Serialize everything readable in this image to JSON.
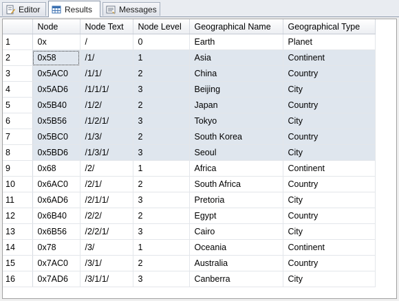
{
  "tabs": [
    {
      "label": "Editor",
      "icon": "editor-icon",
      "active": false
    },
    {
      "label": "Results",
      "icon": "results-grid-icon",
      "active": true
    },
    {
      "label": "Messages",
      "icon": "messages-icon",
      "active": false
    }
  ],
  "grid": {
    "columns": [
      "Node",
      "Node Text",
      "Node Level",
      "Geographical Name",
      "Geographical Type"
    ],
    "rows": [
      {
        "num": "1",
        "cells": [
          "0x",
          "/",
          "0",
          "Earth",
          "Planet"
        ]
      },
      {
        "num": "2",
        "cells": [
          "0x58",
          "/1/",
          "1",
          "Asia",
          "Continent"
        ]
      },
      {
        "num": "3",
        "cells": [
          "0x5AC0",
          "/1/1/",
          "2",
          "China",
          "Country"
        ]
      },
      {
        "num": "4",
        "cells": [
          "0x5AD6",
          "/1/1/1/",
          "3",
          "Beijing",
          "City"
        ]
      },
      {
        "num": "5",
        "cells": [
          "0x5B40",
          "/1/2/",
          "2",
          "Japan",
          "Country"
        ]
      },
      {
        "num": "6",
        "cells": [
          "0x5B56",
          "/1/2/1/",
          "3",
          "Tokyo",
          "City"
        ]
      },
      {
        "num": "7",
        "cells": [
          "0x5BC0",
          "/1/3/",
          "2",
          "South Korea",
          "Country"
        ]
      },
      {
        "num": "8",
        "cells": [
          "0x5BD6",
          "/1/3/1/",
          "3",
          "Seoul",
          "City"
        ]
      },
      {
        "num": "9",
        "cells": [
          "0x68",
          "/2/",
          "1",
          "Africa",
          "Continent"
        ]
      },
      {
        "num": "10",
        "cells": [
          "0x6AC0",
          "/2/1/",
          "2",
          "South Africa",
          "Country"
        ]
      },
      {
        "num": "11",
        "cells": [
          "0x6AD6",
          "/2/1/1/",
          "3",
          "Pretoria",
          "City"
        ]
      },
      {
        "num": "12",
        "cells": [
          "0x6B40",
          "/2/2/",
          "2",
          "Egypt",
          "Country"
        ]
      },
      {
        "num": "13",
        "cells": [
          "0x6B56",
          "/2/2/1/",
          "3",
          "Cairo",
          "City"
        ]
      },
      {
        "num": "14",
        "cells": [
          "0x78",
          "/3/",
          "1",
          "Oceania",
          "Continent"
        ]
      },
      {
        "num": "15",
        "cells": [
          "0x7AC0",
          "/3/1/",
          "2",
          "Australia",
          "Country"
        ]
      },
      {
        "num": "16",
        "cells": [
          "0x7AD6",
          "/3/1/1/",
          "3",
          "Canberra",
          "City"
        ]
      }
    ],
    "selected_rows": [
      "2",
      "3",
      "4",
      "5",
      "6",
      "7",
      "8"
    ],
    "focused_cell": {
      "row": "2",
      "column": "Node"
    },
    "selection_color": "#dfe6ee"
  }
}
